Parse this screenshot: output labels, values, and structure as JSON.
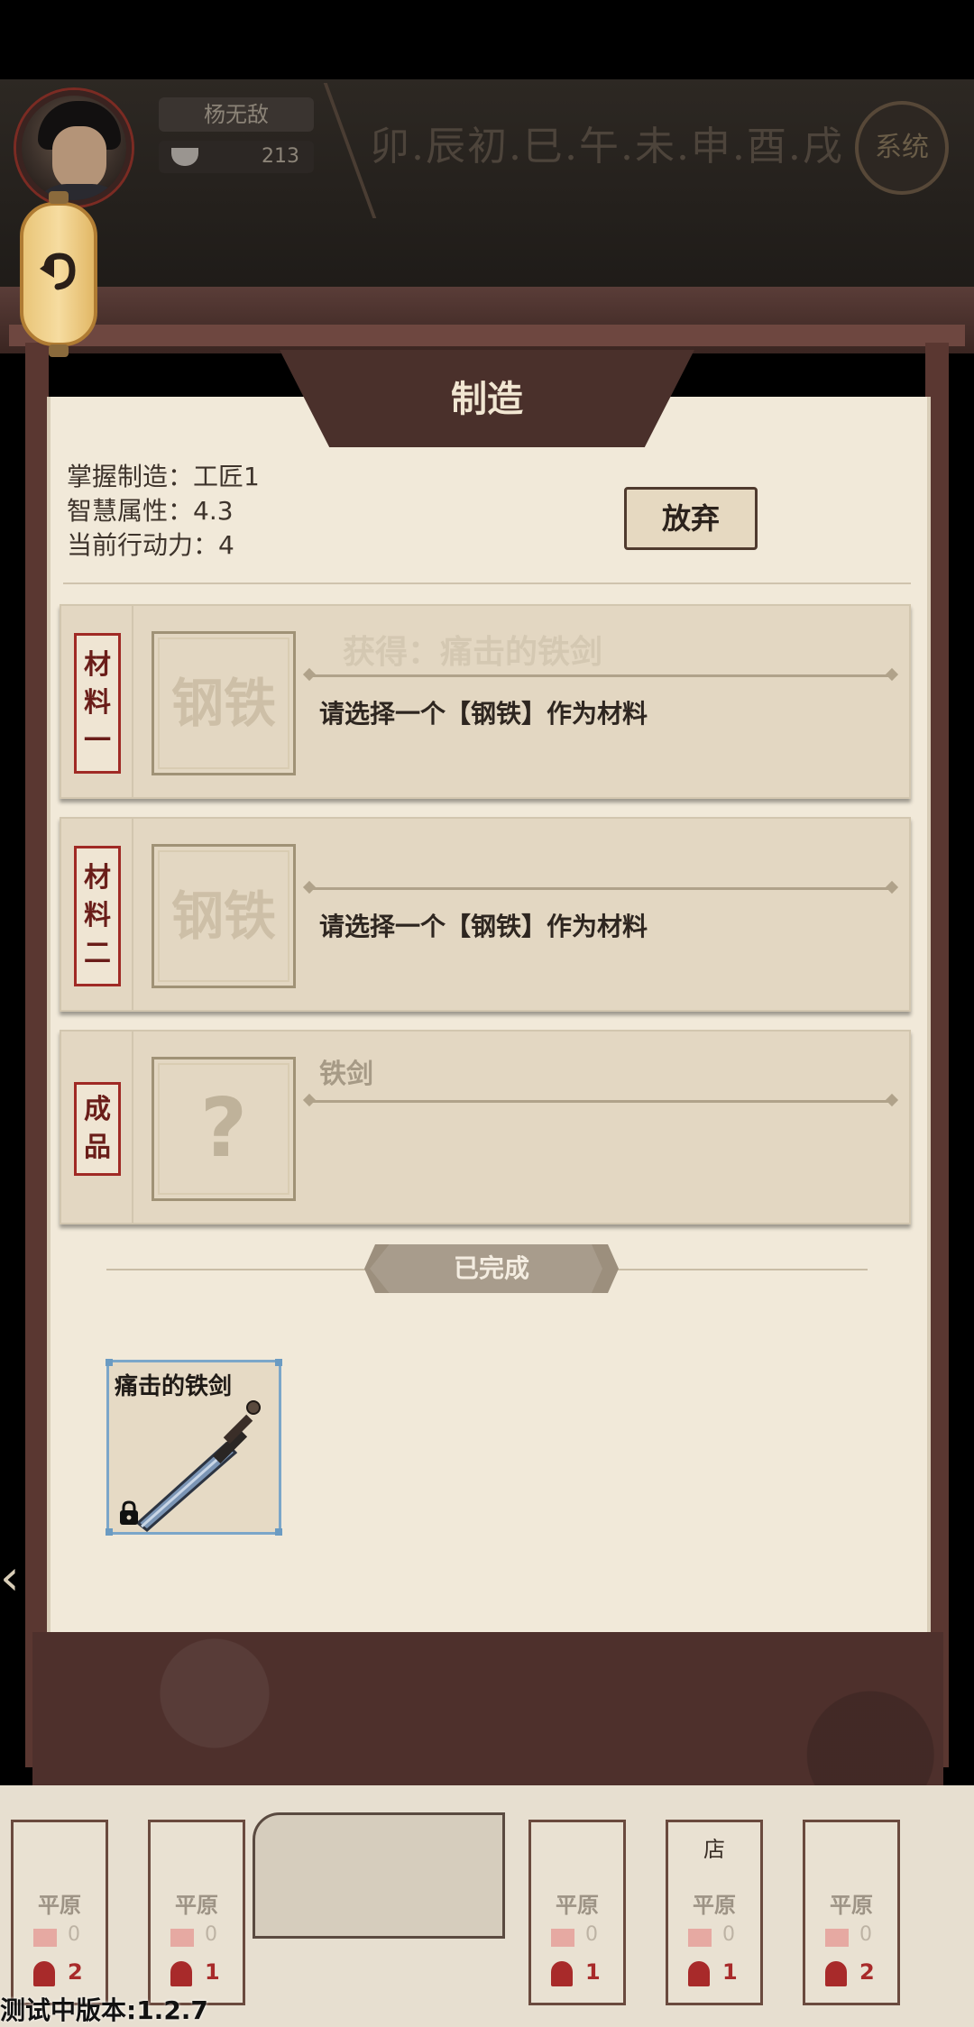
{
  "header": {
    "player_name": "杨无敌",
    "coins": "213",
    "time_bar": "卯.辰初.巳.午.未.申.酉.戌",
    "system_label": "系统"
  },
  "dialog": {
    "title": "制造",
    "stats": [
      "掌握制造：工匠1",
      "智慧属性：4.3",
      "当前行动力：4"
    ],
    "giveup_label": "放弃",
    "ghost_text": "获得：痛击的铁剑",
    "slots": [
      {
        "tag_chars": [
          "材",
          "料",
          "一"
        ],
        "material": "钢铁",
        "hint": "请选择一个【钢铁】作为材料"
      },
      {
        "tag_chars": [
          "材",
          "料",
          "二"
        ],
        "material": "钢铁",
        "hint": "请选择一个【钢铁】作为材料"
      }
    ],
    "product": {
      "tag_chars": [
        "成",
        "品"
      ],
      "placeholder": "?",
      "name": "铁剑"
    },
    "completed_label": "已完成",
    "result_item": {
      "name": "痛击的铁剑",
      "icon": "sword-icon",
      "locked": true
    }
  },
  "map_cards": [
    {
      "top": "",
      "name": "平原",
      "flags": "0",
      "people": "2"
    },
    {
      "top": "",
      "name": "平原",
      "flags": "0",
      "people": "1"
    },
    {
      "top": "",
      "name": "平原",
      "flags": "0",
      "people": "1"
    },
    {
      "top": "店",
      "name": "平原",
      "flags": "0",
      "people": "1"
    },
    {
      "top": "",
      "name": "平原",
      "flags": "0",
      "people": "2"
    }
  ],
  "version_text": "测试中版本:1.2.7",
  "colors": {
    "frame": "#4e302c",
    "panel": "#f1e9d9",
    "tag_red": "#a02a25",
    "item_border": "#7ba6c9"
  }
}
